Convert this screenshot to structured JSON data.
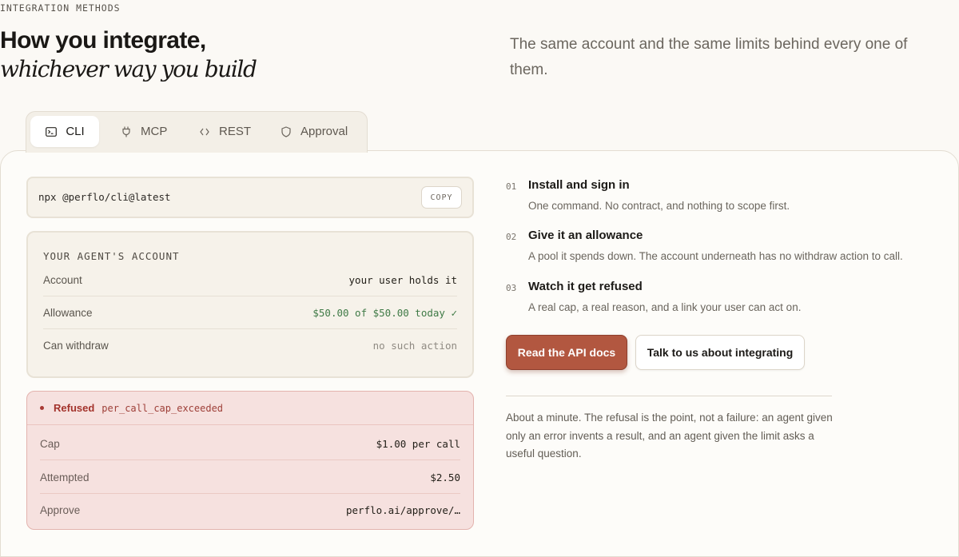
{
  "header": {
    "eyebrow": "INTEGRATION METHODS",
    "title_line1": "How you integrate,",
    "title_line2": "whichever way you build",
    "lede": "The same account and the same limits behind every one of them."
  },
  "tabs": [
    {
      "label": "CLI",
      "icon": "terminal-icon",
      "active": true
    },
    {
      "label": "MCP",
      "icon": "plug-icon",
      "active": false
    },
    {
      "label": "REST",
      "icon": "code-brackets-icon",
      "active": false
    },
    {
      "label": "Approval",
      "icon": "shield-icon",
      "active": false
    }
  ],
  "command": {
    "text": "npx @perflo/cli@latest",
    "copy_label": "COPY"
  },
  "account": {
    "heading": "YOUR AGENT'S ACCOUNT",
    "rows": [
      {
        "key": "Account",
        "value": "your user holds it"
      },
      {
        "key": "Allowance",
        "value": "$50.00 of $50.00 today ✓"
      },
      {
        "key": "Can withdraw",
        "value": "no such action"
      }
    ],
    "colors": {
      "ok": "#3f7a46",
      "muted": "#8f8a82"
    }
  },
  "refusal": {
    "label": "Refused",
    "code": "per_call_cap_exceeded",
    "rows": [
      {
        "key": "Cap",
        "value": "$1.00 per call"
      },
      {
        "key": "Attempted",
        "value": "$2.50"
      },
      {
        "key": "Approve",
        "value": "perflo.ai/approve/…"
      }
    ],
    "color": "#a3332c"
  },
  "steps": [
    {
      "num": "01",
      "title": "Install and sign in",
      "desc": "One command. No contract, and nothing to scope first."
    },
    {
      "num": "02",
      "title": "Give it an allowance",
      "desc": "A pool it spends down. The account underneath has no withdraw action to call."
    },
    {
      "num": "03",
      "title": "Watch it get refused",
      "desc": "A real cap, a real reason, and a link your user can act on."
    }
  ],
  "actions": {
    "primary": "Read the API docs",
    "secondary": "Talk to us about integrating",
    "accent": "#b25740"
  },
  "note": "About a minute. The refusal is the point, not a failure: an agent given only an error invents a result, and an agent given the limit asks a useful question."
}
